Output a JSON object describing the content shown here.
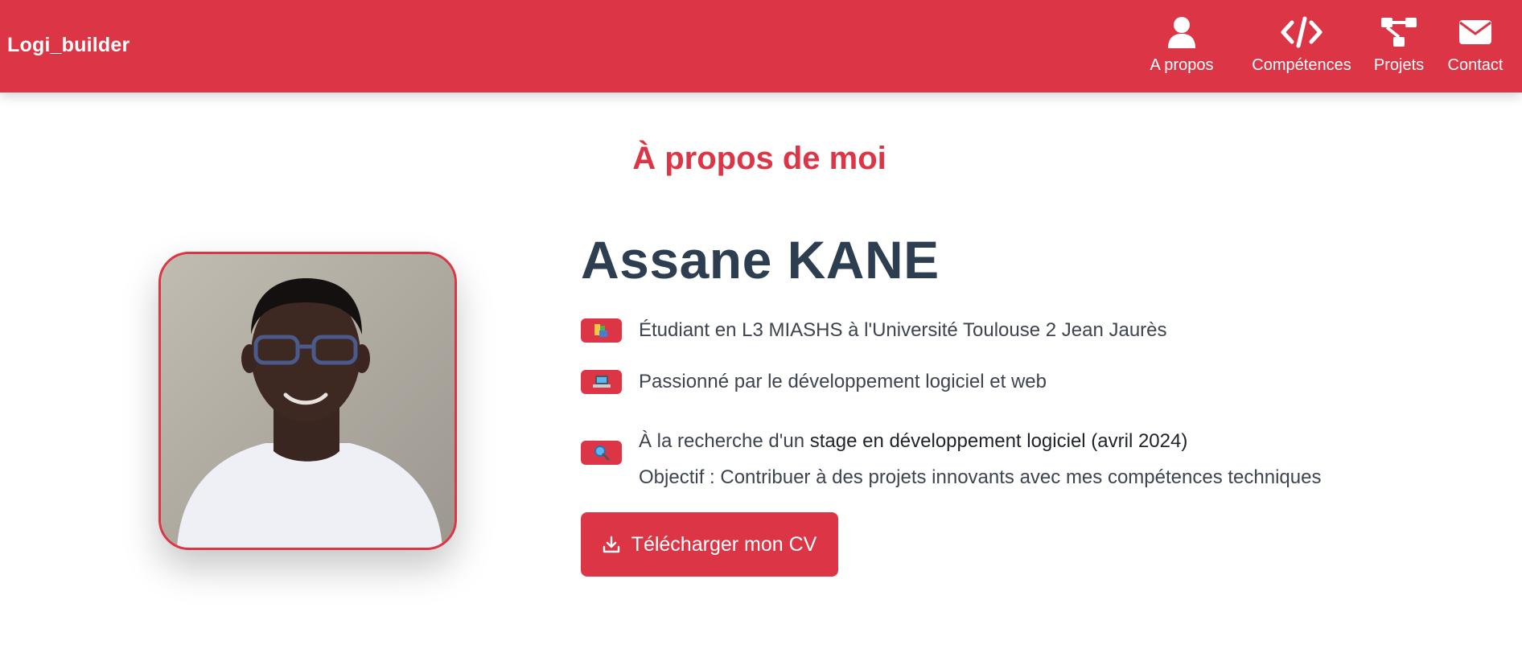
{
  "header": {
    "brand": "Logi_builder",
    "nav": [
      {
        "label": "A propos",
        "icon": "user-icon"
      },
      {
        "label": "Compétences",
        "icon": "code-icon"
      },
      {
        "label": "Projets",
        "icon": "project-diagram-icon"
      },
      {
        "label": "Contact",
        "icon": "envelope-icon"
      }
    ]
  },
  "about": {
    "section_title": "À propos de moi",
    "name": "Assane KANE",
    "items": [
      {
        "icon": "books-icon",
        "text": "Étudiant en L3 MIASHS à l'Université Toulouse 2 Jean Jaurès"
      },
      {
        "icon": "laptop-icon",
        "text": "Passionné par le développement logiciel et web"
      },
      {
        "icon": "magnifier-icon",
        "text_prefix": "À la recherche d'un ",
        "text_highlight": "stage en développement logiciel (avril 2024)",
        "text_line2": "Objectif : Contribuer à des projets innovants avec mes compétences techniques"
      }
    ],
    "cv_button": "Télécharger mon CV"
  },
  "colors": {
    "accent": "#dc3545",
    "heading": "#2c3e50",
    "text": "#3d4450"
  }
}
